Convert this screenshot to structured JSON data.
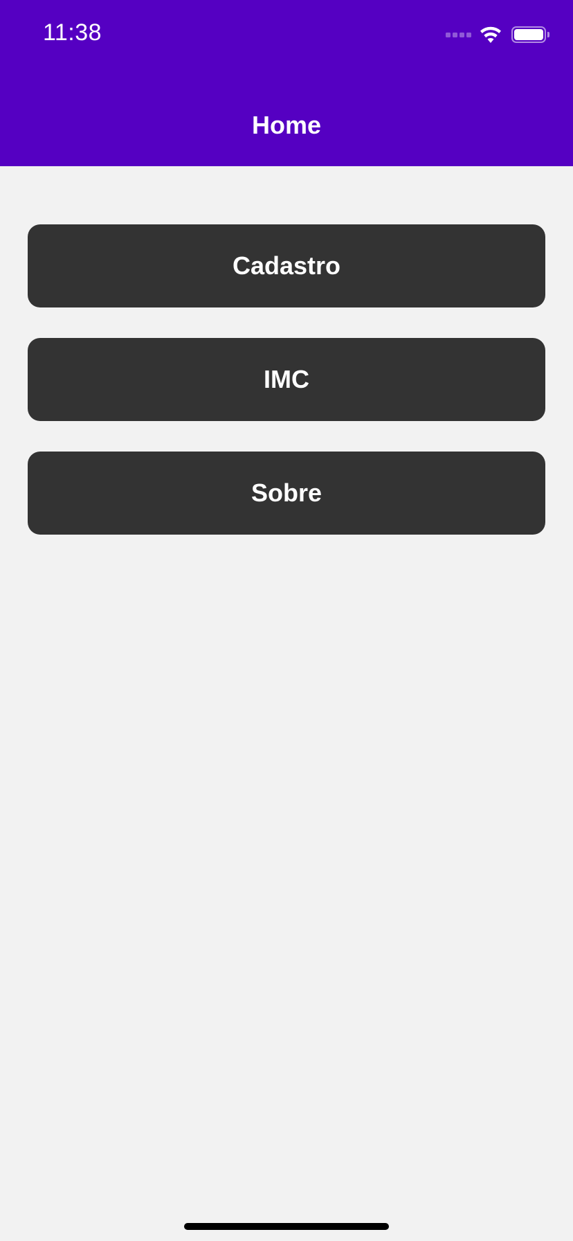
{
  "status_bar": {
    "time": "11:38",
    "signal_icon": "cellular-signal-icon",
    "wifi_icon": "wifi-icon",
    "battery_icon": "battery-icon",
    "battery_level": 1.0
  },
  "header": {
    "title": "Home",
    "background_color": "#5500c2"
  },
  "menu": {
    "buttons": [
      {
        "label": "Cadastro"
      },
      {
        "label": "IMC"
      },
      {
        "label": "Sobre"
      }
    ],
    "button_color": "#333333"
  },
  "page": {
    "background_color": "#f2f2f2"
  }
}
